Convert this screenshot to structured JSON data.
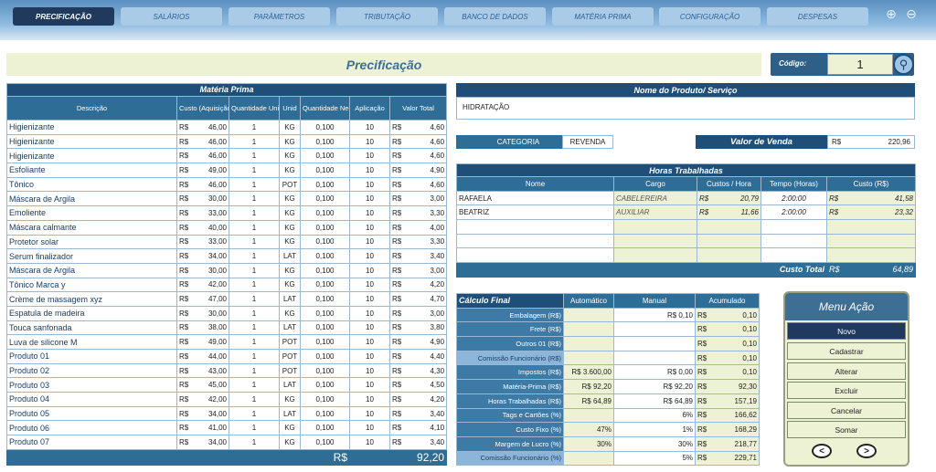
{
  "nav": {
    "tabs": [
      "PRECIFICAÇÃO",
      "SALÁRIOS",
      "PARÂMETROS",
      "TRIBUTAÇÃO",
      "BANCO DE DADOS",
      "MATÉRIA PRIMA",
      "CONFIGURAÇÃO",
      "DESPESAS"
    ],
    "active_index": 0
  },
  "page_title": "Precificação",
  "codigo": {
    "label": "Código:",
    "value": "1"
  },
  "materia_prima": {
    "title": "Matéria Prima",
    "headers": [
      "Descrição",
      "Custo (Aquisição)",
      "Quantidade Unitária",
      "Unid",
      "Quantidade Necessária",
      "Aplicação",
      "Valor Total"
    ],
    "currency": "R$",
    "rows": [
      [
        "Higienizante",
        "46,00",
        "1",
        "KG",
        "0,100",
        "10",
        "4,60"
      ],
      [
        "Higienizante",
        "46,00",
        "1",
        "KG",
        "0,100",
        "10",
        "4,60"
      ],
      [
        "Higienizante",
        "46,00",
        "1",
        "KG",
        "0,100",
        "10",
        "4,60"
      ],
      [
        "Esfoliante",
        "49,00",
        "1",
        "KG",
        "0,100",
        "10",
        "4,90"
      ],
      [
        "Tônico",
        "46,00",
        "1",
        "POT",
        "0,100",
        "10",
        "4,60"
      ],
      [
        "Máscara de Argila",
        "30,00",
        "1",
        "KG",
        "0,100",
        "10",
        "3,00"
      ],
      [
        "Emoliente",
        "33,00",
        "1",
        "KG",
        "0,100",
        "10",
        "3,30"
      ],
      [
        "Máscara calmante",
        "40,00",
        "1",
        "KG",
        "0,100",
        "10",
        "4,00"
      ],
      [
        "Protetor solar",
        "33,00",
        "1",
        "KG",
        "0,100",
        "10",
        "3,30"
      ],
      [
        "Serum finalizador",
        "34,00",
        "1",
        "LAT",
        "0,100",
        "10",
        "3,40"
      ],
      [
        "Máscara de Argila",
        "30,00",
        "1",
        "KG",
        "0,100",
        "10",
        "3,00"
      ],
      [
        "Tônico Marca y",
        "42,00",
        "1",
        "KG",
        "0,100",
        "10",
        "4,20"
      ],
      [
        "Crème de massagem xyz",
        "47,00",
        "1",
        "LAT",
        "0,100",
        "10",
        "4,70"
      ],
      [
        "Espatula de madeira",
        "30,00",
        "1",
        "KG",
        "0,100",
        "10",
        "3,00"
      ],
      [
        "Touca sanfonada",
        "38,00",
        "1",
        "LAT",
        "0,100",
        "10",
        "3,80"
      ],
      [
        "Luva de silicone M",
        "49,00",
        "1",
        "POT",
        "0,100",
        "10",
        "4,90"
      ],
      [
        "Produto 01",
        "44,00",
        "1",
        "POT",
        "0,100",
        "10",
        "4,40"
      ],
      [
        "Produto 02",
        "43,00",
        "1",
        "POT",
        "0,100",
        "10",
        "4,30"
      ],
      [
        "Produto 03",
        "45,00",
        "1",
        "LAT",
        "0,100",
        "10",
        "4,50"
      ],
      [
        "Produto 04",
        "42,00",
        "1",
        "KG",
        "0,100",
        "10",
        "4,20"
      ],
      [
        "Produto 05",
        "34,00",
        "1",
        "LAT",
        "0,100",
        "10",
        "3,40"
      ],
      [
        "Produto 06",
        "41,00",
        "1",
        "KG",
        "0,100",
        "10",
        "4,10"
      ],
      [
        "Produto 07",
        "34,00",
        "1",
        "KG",
        "0,100",
        "10",
        "3,40"
      ]
    ],
    "total_currency": "R$",
    "total": "92,20"
  },
  "produto": {
    "header": "Nome do Produto/ Serviço",
    "value": "HIDRATAÇÃO"
  },
  "categoria": {
    "label": "CATEGORIA",
    "value": "REVENDA"
  },
  "valor_venda": {
    "label": "Valor de Venda",
    "currency": "R$",
    "value": "220,96"
  },
  "horas": {
    "title": "Horas Trabalhadas",
    "headers": [
      "Nome",
      "Cargo",
      "Custos / Hora",
      "Tempo (Horas)",
      "Custo (R$)"
    ],
    "rows": [
      [
        "RAFAELA",
        "CABELEREIRA",
        "20,79",
        "2:00:00",
        "41,58"
      ],
      [
        "BEATRIZ",
        "AUXILIAR",
        "11,66",
        "2:00:00",
        "23,32"
      ],
      [
        "",
        "",
        "",
        "",
        ""
      ],
      [
        "",
        "",
        "",
        "",
        ""
      ],
      [
        "",
        "",
        "",
        "",
        ""
      ]
    ],
    "currency": "R$",
    "total_label": "Custo Total",
    "total": "64,89"
  },
  "calculo": {
    "title": "Cálculo Final",
    "headers": [
      "Automático",
      "Manual",
      "Acumulado"
    ],
    "rows": [
      {
        "label": "Embalagem (R$)",
        "auto": "",
        "manual": "R$ 0,10",
        "acc": "0,10",
        "alt": false
      },
      {
        "label": "Frete (R$)",
        "auto": "",
        "manual": "",
        "acc": "0,10",
        "alt": false
      },
      {
        "label": "Outros 01 (R$)",
        "auto": "",
        "manual": "",
        "acc": "0,10",
        "alt": false
      },
      {
        "label": "Comissão Funcionário (R$)",
        "auto": "",
        "manual": "",
        "acc": "0,10",
        "alt": true
      },
      {
        "label": "Impostos (R$)",
        "auto": "R$ 3.600,00",
        "manual": "R$ 0,00",
        "acc": "0,10",
        "alt": false
      },
      {
        "label": "Matéria-Prima (R$)",
        "auto": "R$ 92,20",
        "manual": "R$ 92,20",
        "acc": "92,30",
        "alt": false
      },
      {
        "label": "Horas Trabalhadas (R$)",
        "auto": "R$ 64,89",
        "manual": "R$ 64,89",
        "acc": "157,19",
        "alt": false
      },
      {
        "label": "Tags e Cartões (%)",
        "auto": "",
        "manual": "6%",
        "acc": "166,62",
        "alt": false
      },
      {
        "label": "Custo Fixo (%)",
        "auto": "47%",
        "manual": "1%",
        "acc": "168,29",
        "alt": false
      },
      {
        "label": "Margem de Lucro (%)",
        "auto": "30%",
        "manual": "30%",
        "acc": "218,77",
        "alt": false
      },
      {
        "label": "Comissão Funcionário (%)",
        "auto": "",
        "manual": "5%",
        "acc": "229,71",
        "alt": true
      }
    ],
    "currency": "R$"
  },
  "menu": {
    "title": "Menu Ação",
    "buttons": [
      "Novo",
      "Cadastrar",
      "Alterar",
      "Excluir",
      "Cancelar",
      "Somar"
    ],
    "prev": "<",
    "next": ">"
  }
}
